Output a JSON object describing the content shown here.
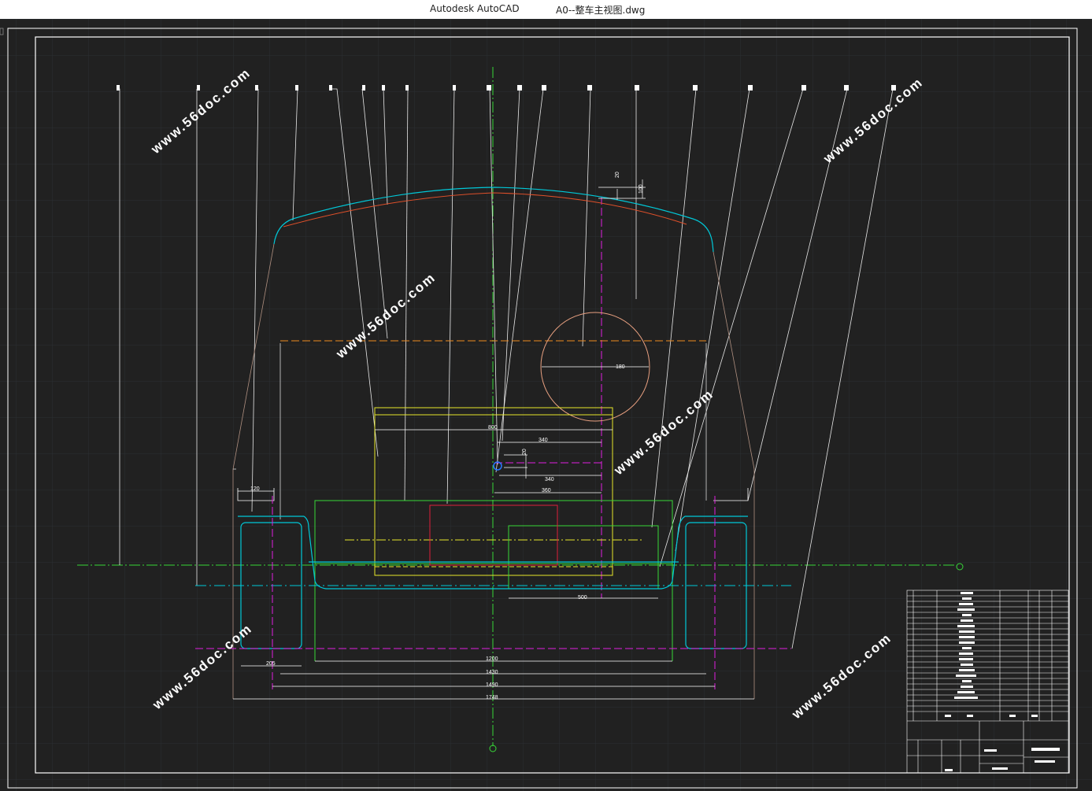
{
  "window": {
    "app_name": "Autodesk AutoCAD",
    "file_name": "A0--整车主视图.dwg"
  },
  "drawing": {
    "dimensions": {
      "d20_top": "20",
      "d100_top": "100",
      "d180": "180",
      "d800": "800",
      "d340_a": "340",
      "d20_mid": "20",
      "d340_b": "340",
      "d360": "360",
      "d120": "120",
      "d500": "500",
      "d205": "205",
      "d1200": "1200",
      "d1430": "1430",
      "d1490": "1490",
      "d1748": "1748"
    },
    "watermark": "www.56doc.com",
    "colors": {
      "background": "#212121",
      "frame": "#ffffff",
      "body_outline": "#00c8d8",
      "roof_line": "#e0502a",
      "yellow": "#e8e82a",
      "green": "#38d838",
      "magenta": "#e020e0",
      "red": "#e0203a",
      "orange": "#f08a20",
      "circle": "#e8a080",
      "watermark": "#e53a3a"
    }
  }
}
